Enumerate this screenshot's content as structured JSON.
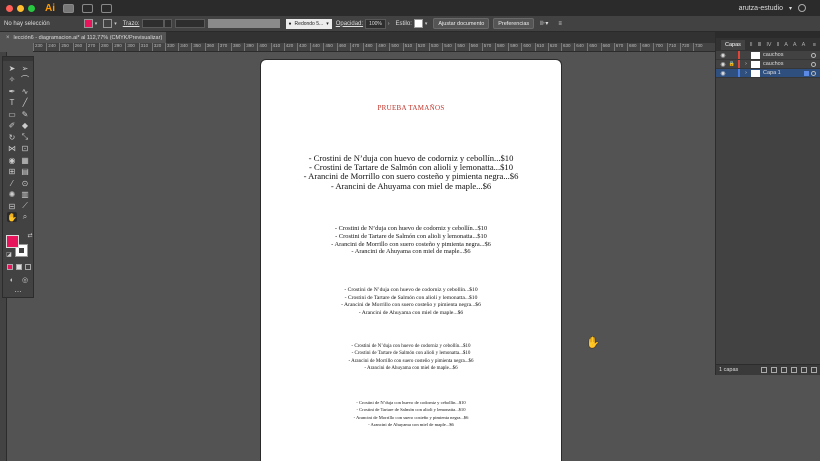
{
  "app": {
    "logo": "Ai",
    "workspace": "arutza-estudio"
  },
  "control_bar": {
    "selection_label": "No hay selección",
    "stroke_label": "Trazo:",
    "brush_select": "Redondo 5...",
    "opacity_label": "Opacidad:",
    "opacity_value": "100%",
    "style_label": "Estilo:",
    "adjust_document_label": "Ajustar documento",
    "preferences_label": "Preferencias",
    "fill_color": "#e8145c"
  },
  "document_tab": {
    "label": "lección6 - diagramacion.ai* al 112,77% (CMYK/Previsualizar)",
    "close_glyph": "×"
  },
  "ruler": {
    "ticks": [
      "230",
      "240",
      "250",
      "260",
      "270",
      "280",
      "290",
      "300",
      "310",
      "320",
      "330",
      "340",
      "350",
      "360",
      "370",
      "380",
      "390",
      "400",
      "410",
      "420",
      "430",
      "440",
      "450",
      "460",
      "470",
      "480",
      "490",
      "500",
      "510",
      "520",
      "530",
      "540",
      "550",
      "560",
      "570",
      "580",
      "590",
      "600",
      "610",
      "620",
      "630",
      "640",
      "650",
      "660",
      "670",
      "680",
      "690",
      "700",
      "710",
      "720",
      "730"
    ]
  },
  "artboard": {
    "title": "PRUEBA TAMAÑOS",
    "title_color": "#c0342a",
    "blocks": [
      [
        "- Crostini de N’duja con huevo de codorniz y cebollín...$10",
        "- Crostini de Tartare de Salmón con alioli y lemonatta...$10",
        "- Arancini de Morrillo con suero costeño y pimienta negra...$6",
        "- Arancini de Ahuyama con miel de maple...$6"
      ],
      [
        "- Crostini de N’duja con huevo de codorniz y cebollín...$10",
        "- Crostini de Tartare de Salmón con alioli y lemonatta...$10",
        "- Arancini de Morrillo con suero costeño y pimienta negra...$6",
        "- Arancini de Ahuyama con miel de maple...$6"
      ],
      [
        "- Crostini de N’duja con huevo de codorniz y cebollín...$10",
        "- Crostini de Tartare de Salmón con alioli y lemonatta...$10",
        "- Arancini de Morrillo con suero costeño y pimienta negra...$6",
        "- Arancini de Ahuyama con miel de maple...$6"
      ],
      [
        "- Crostini de N’duja con huevo de codorniz y cebollín...$10",
        "- Crostini de Tartare de Salmón con alioli y lemonatta...$10",
        "- Arancini de Morrillo con suero costeño y pimienta negra...$6",
        "- Arancini de Ahuyama con miel de maple...$6"
      ],
      [
        "- Crostini de N’duja con huevo de codorniz y cebollín...$10",
        "- Crostini de Tartare de Salmón con alioli y lemonatta...$10",
        "- Arancini de Morrillo con suero costeño y pimienta negra...$6",
        "- Arancini de Ahuyama con miel de maple...$6"
      ]
    ]
  },
  "layers_panel": {
    "tabs": [
      "Capas",
      "Ⅱ",
      "Ⅲ",
      "Ⅳ",
      "Ⅱ",
      "A",
      "A",
      "A"
    ],
    "menu_glyph": "≡",
    "layers": [
      {
        "name": "cauchos",
        "color": "#e0453a",
        "locked": false,
        "selected": false
      },
      {
        "name": "cauchos",
        "color": "#e0453a",
        "locked": true,
        "selected": false
      },
      {
        "name": "Capa 1",
        "color": "#4a7dde",
        "locked": false,
        "selected": true
      }
    ],
    "footer_count": "1 capas"
  }
}
